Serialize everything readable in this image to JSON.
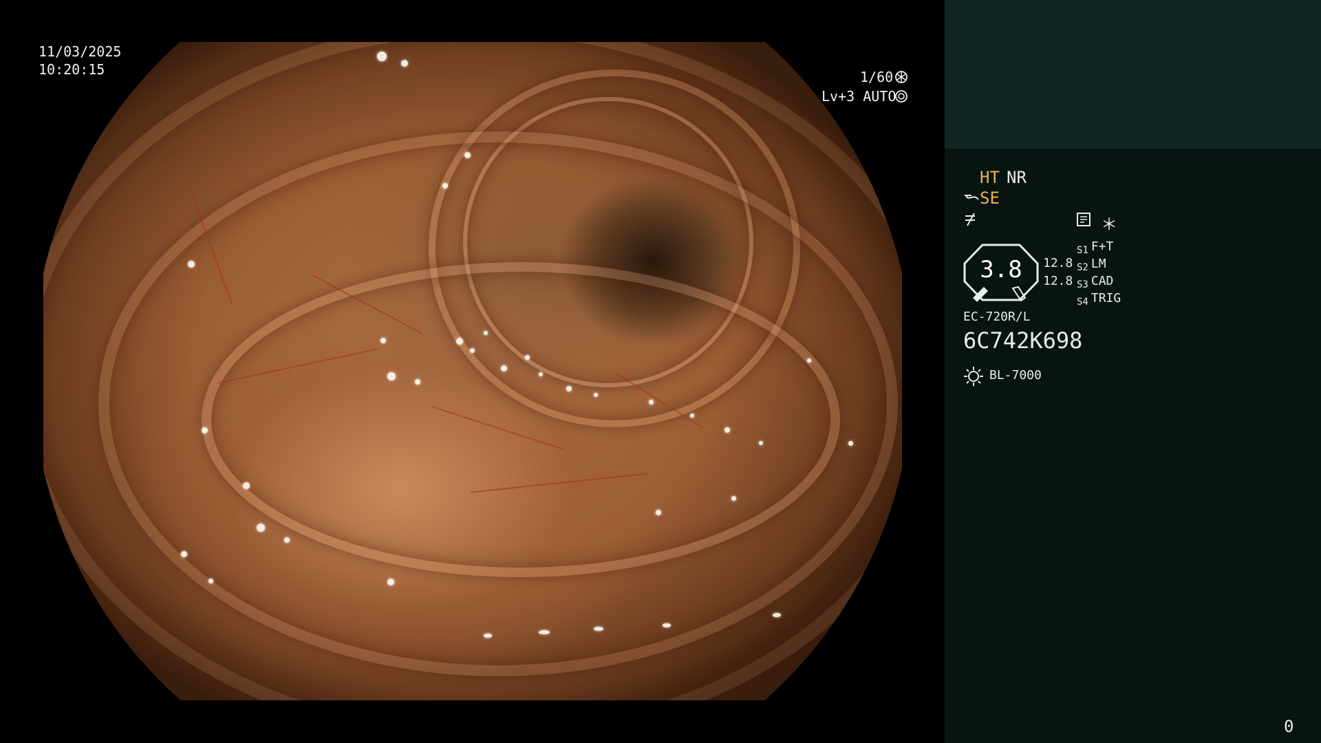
{
  "overlay": {
    "date": "11/03/2025",
    "time": "10:20:15",
    "shutter": "1/60",
    "iris": "Lv+3 AUTO"
  },
  "panel": {
    "ht": "HT",
    "nr": "NR",
    "se": "SE",
    "gauge_value": "3.8",
    "level_a": "12.8",
    "level_b": "12.8",
    "switches": [
      {
        "key": "S1",
        "value": "F+T"
      },
      {
        "key": "S2",
        "value": "LM"
      },
      {
        "key": "S3",
        "value": "CAD"
      },
      {
        "key": "S4",
        "value": "TRIG"
      }
    ],
    "scope_model": "EC-720R/L",
    "scope_serial": "6C742K698",
    "light_source": "BL-7000",
    "star": "＊",
    "counter": "0"
  },
  "colors": {
    "panel_background": "#071410",
    "panel_top": "#0f2623",
    "highlight": "#f0b050"
  },
  "icons": [
    "shutter-icon",
    "iris-icon",
    "enhance-icon",
    "freeze-icon",
    "record-icon",
    "light-source-icon",
    "gauge-icon"
  ]
}
